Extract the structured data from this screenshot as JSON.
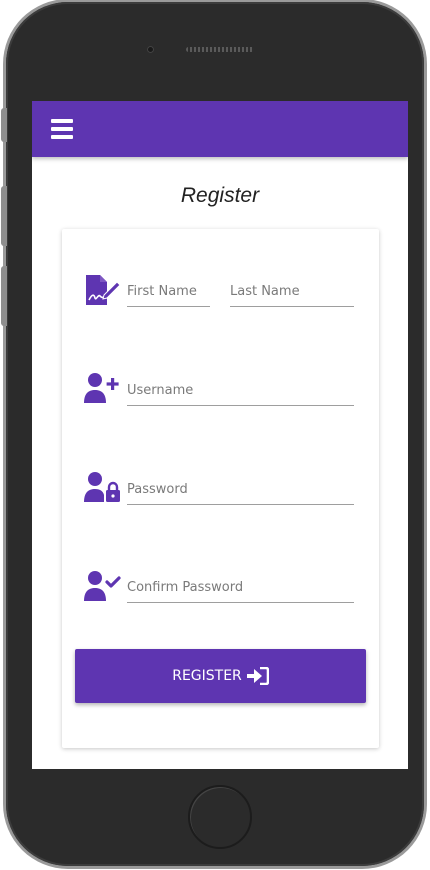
{
  "app_bar": {
    "menu_icon": "hamburger-menu-icon",
    "color": "#5e35b1"
  },
  "page": {
    "title": "Register"
  },
  "form": {
    "name_row_icon": "signature-icon",
    "first_name": {
      "placeholder": "First Name",
      "value": ""
    },
    "last_name": {
      "placeholder": "Last Name",
      "value": ""
    },
    "username_row_icon": "user-plus-icon",
    "username": {
      "placeholder": "Username",
      "value": ""
    },
    "password_row_icon": "user-lock-icon",
    "password": {
      "placeholder": "Password",
      "value": ""
    },
    "confirm_row_icon": "user-check-icon",
    "confirm_password": {
      "placeholder": "Confirm Password",
      "value": ""
    },
    "submit": {
      "label": "REGISTER",
      "icon": "sign-in-icon"
    }
  },
  "colors": {
    "accent": "#5e35b1",
    "icon": "#5e35b1",
    "underline": "#9e9e9e"
  }
}
